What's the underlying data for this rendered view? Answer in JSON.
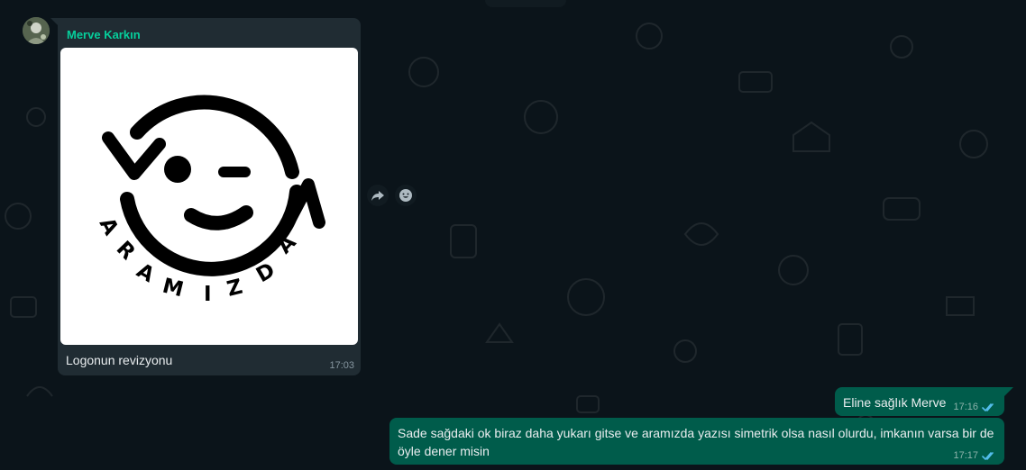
{
  "colors": {
    "background": "#0b141a",
    "incoming_bubble": "#202c33",
    "outgoing_bubble": "#005c4b",
    "sender_name": "#06cf9c",
    "read_ticks": "#53bdeb",
    "timestamp": "#8696a0"
  },
  "incoming_message": {
    "sender": "Merve Karkın",
    "avatar_icon": "user-avatar",
    "image": {
      "type": "logo",
      "icon": "aramizda-logo",
      "letters": [
        "A",
        "R",
        "A",
        "M",
        "I",
        "Z",
        "D",
        "A"
      ]
    },
    "caption": "Logonun revizyonu",
    "time": "17:03"
  },
  "actions": {
    "forward_icon": "forward-icon",
    "react_icon": "emoji-icon"
  },
  "outgoing_messages": [
    {
      "text": "Eline sağlık Merve",
      "time": "17:16",
      "status_icon": "double-check-icon"
    },
    {
      "text": "Sade sağdaki ok biraz daha yukarı gitse ve aramızda yazısı simetrik olsa nasıl olurdu, imkanın varsa bir de öyle dener misin",
      "time": "17:17",
      "status_icon": "double-check-icon"
    }
  ]
}
